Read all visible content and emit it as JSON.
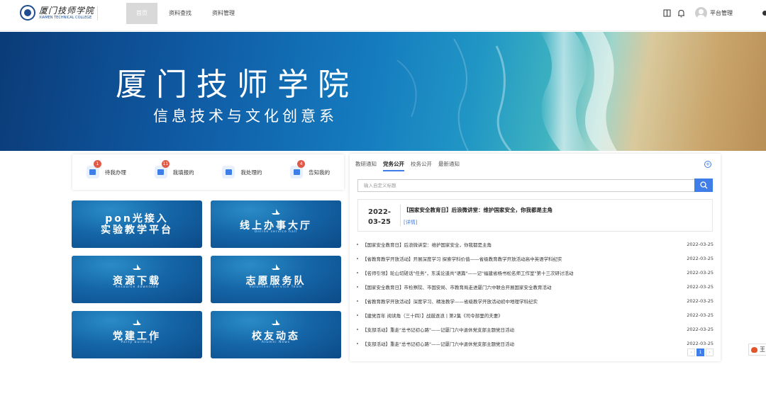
{
  "header": {
    "logo_cn": "厦门技师学院",
    "logo_en": "XIAMEN TECHNICAL COLLEGE",
    "nav": [
      {
        "label": "首页",
        "active": true
      },
      {
        "label": "资料查找",
        "active": false
      },
      {
        "label": "资料管理",
        "active": false
      }
    ],
    "icons": [
      "book-icon",
      "bell-icon"
    ],
    "user_name": "平台管理"
  },
  "banner": {
    "title": "厦门技师学院",
    "subtitle": "信息技术与文化创意系"
  },
  "tasks": [
    {
      "label": "待我办理",
      "badge": "1",
      "icon": "monitor-icon"
    },
    {
      "label": "我填报的",
      "badge": "11",
      "icon": "document-icon"
    },
    {
      "label": "我处理的",
      "badge": "",
      "icon": "check-icon"
    },
    {
      "label": "告知我的",
      "badge": "4",
      "icon": "bell-icon"
    }
  ],
  "tiles": [
    {
      "title": "pon光接入\n实验教学平台",
      "subtitle": ""
    },
    {
      "title": "线上办事大厅",
      "subtitle": "Online service hall"
    },
    {
      "title": "资源下载",
      "subtitle": "Resource download"
    },
    {
      "title": "志愿服务队",
      "subtitle": "Volunteer Service Team"
    },
    {
      "title": "党建工作",
      "subtitle": "Party building"
    },
    {
      "title": "校友动态",
      "subtitle": "Alumni News"
    }
  ],
  "news": {
    "tabs": [
      {
        "label": "教研通知",
        "active": false
      },
      {
        "label": "党务公开",
        "active": true
      },
      {
        "label": "校务公开",
        "active": false
      },
      {
        "label": "最新通知",
        "active": false
      }
    ],
    "search_placeholder": "输入自定义标题",
    "featured": {
      "year": "2022-",
      "day": "03-25",
      "title": "【国家安全教育日】后浪微讲堂：维护国家安全，你我都是主角",
      "more": "[详情]"
    },
    "items": [
      {
        "title": "【国家安全教育日】后浪微讲堂：维护国家安全，你我都是主角",
        "date": "2022-03-25"
      },
      {
        "title": "【省教育教学开放活动】开展深度学习 探索学科价值——省级教育教学开放活动高中英语学科纪实",
        "date": "2022-03-25"
      },
      {
        "title": "【名师引领】轮山切磋话\"任务\"，东溪论道共\"语篇\"——记\"福建省杨书松名师工作室\"第十三次研讨活动",
        "date": "2022-03-25"
      },
      {
        "title": "【国家安全教育日】市检察院、市国安局、市教育局走进厦门六中联合开展国家安全教育活动",
        "date": "2022-03-25"
      },
      {
        "title": "【省教育教学开放活动】深度学习、精准教学——省级教学开放活动初中地理学科纪实",
        "date": "2022-03-25"
      },
      {
        "title": "【建党百年 阅读角（三十四）】战鼓逐浪 | 第2集《司令部里的夫妻》",
        "date": "2022-03-25"
      },
      {
        "title": "【支部活动】重走\"总书记初心路\"——记厦门六中退休党支部主题党日活动",
        "date": "2022-03-25"
      },
      {
        "title": "【支部活动】重走\"总书记初心路\"——记厦门六中退休党支部主题党日活动",
        "date": "2022-03-25"
      }
    ],
    "pager": {
      "prev": "‹",
      "current": "1",
      "next": "›"
    }
  },
  "side_float": {
    "label": "王"
  },
  "colors": {
    "accent": "#3f7ee8",
    "badge": "#e05a4a",
    "nav_active": "#d9d9d9"
  }
}
